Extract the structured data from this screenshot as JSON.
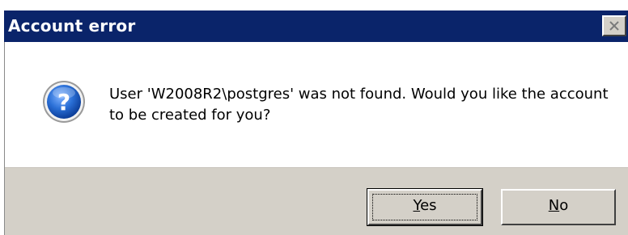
{
  "dialog": {
    "title": "Account error",
    "message": "User 'W2008R2\\postgres' was not found. Would you like the account to be created for you?",
    "icon": "question-icon",
    "buttons": {
      "yes": {
        "mnemonic": "Y",
        "rest": "es"
      },
      "no": {
        "mnemonic": "N",
        "rest": "o"
      }
    },
    "colors": {
      "title_bar": "#0a246a",
      "button_face": "#d4d0c8",
      "icon_blue": "#1f5fbf"
    }
  }
}
